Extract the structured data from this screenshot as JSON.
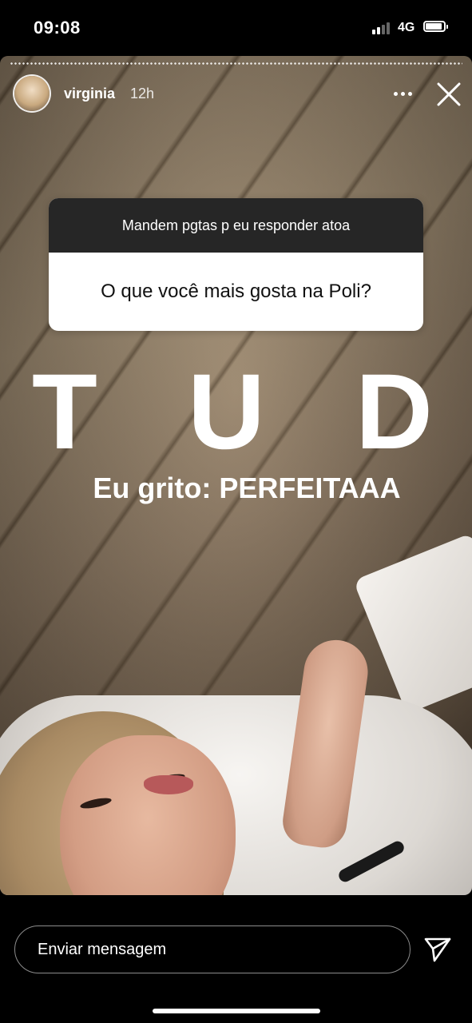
{
  "status_bar": {
    "time": "09:08",
    "network": "4G",
    "battery_level": 0.9,
    "signal_bars": 2
  },
  "story": {
    "username": "virginia",
    "timestamp": "12h",
    "question_sticker": {
      "prompt": "Mandem pgtas p eu responder atoa",
      "question": "O que você mais gosta na Poli?"
    },
    "overlay_title": "T U D O",
    "overlay_subtitle": "Eu grito: PERFEITAAA"
  },
  "reply_bar": {
    "placeholder": "Enviar mensagem"
  },
  "icons": {
    "more": "more-options-icon",
    "close": "close-icon",
    "send": "send-icon"
  },
  "colors": {
    "sticker_header_bg": "#262626",
    "sticker_body_bg": "#ffffff",
    "background": "#000000"
  }
}
